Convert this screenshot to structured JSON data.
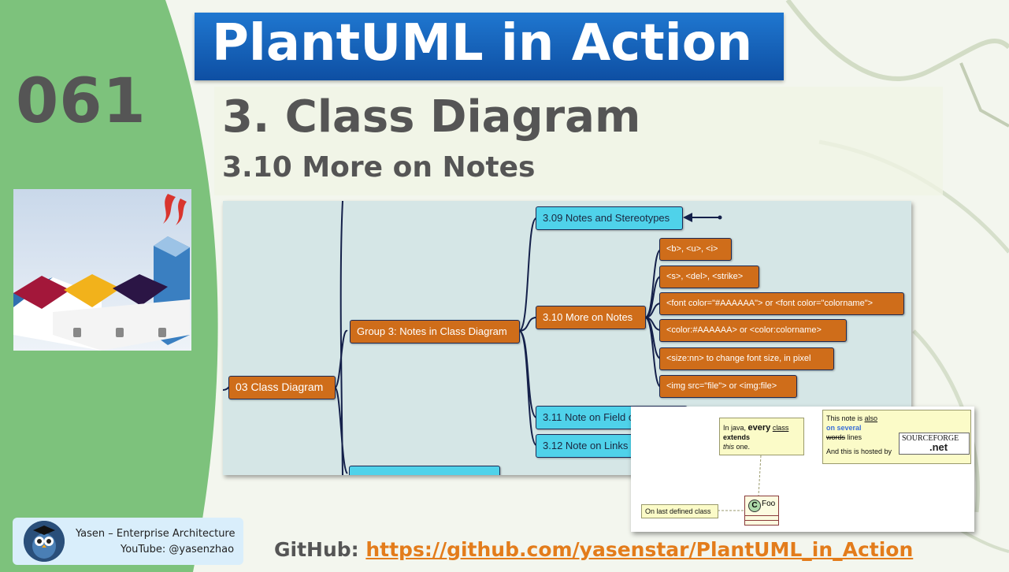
{
  "title": "PlantUML in Action",
  "episode": "061",
  "section_title": "3. Class Diagram",
  "section_subtitle": "3.10 More on Notes",
  "mindmap": {
    "root": "03 Class Diagram",
    "group": "Group 3: Notes in Class Diagram",
    "topic_prev": "3.09 Notes and Stereotypes",
    "topic_current": "3.10 More on Notes",
    "topic_next1": "3.11 Note on Field o",
    "topic_next2": "3.12 Note on Links",
    "children": [
      "<b>, <u>, <i>",
      "<s>, <del>, <strike>",
      "<font color=\"#AAAAAA\"> or <font color=\"colorname\">",
      "<color:#AAAAAA> or <color:colorname>",
      "<size:nn> to change font size, in pixel",
      "<img src=\"file\"> or <img:file>"
    ]
  },
  "uml_example": {
    "note1": {
      "l1a": "In java, ",
      "l1b": "every",
      "l1c": "class",
      "l2": "extends",
      "l3a": "this",
      "l3b": " one."
    },
    "note2": {
      "l1a": "This note is ",
      "l1b": "also",
      "l2": "on several",
      "l3a": "words",
      "l3b": " lines",
      "l4": "And this is hosted by"
    },
    "note3": "On last defined class",
    "class_letter": "C",
    "class_name": "Foo",
    "sf_logo_top": "SOURCEFORGE",
    "sf_logo_bottom": ".net"
  },
  "author": {
    "line1": "Yasen – Enterprise Architecture",
    "line2": "YouTube: @yasenzhao"
  },
  "github": {
    "label": "GitHub: ",
    "url": "https://github.com/yasenstar/PlantUML_in_Action"
  },
  "colors": {
    "banner": "#1565c0",
    "node_orange": "#cf6d1a",
    "node_cyan": "#4fd2ea",
    "link": "#e37c1b",
    "green_arc": "#7dc27c"
  }
}
